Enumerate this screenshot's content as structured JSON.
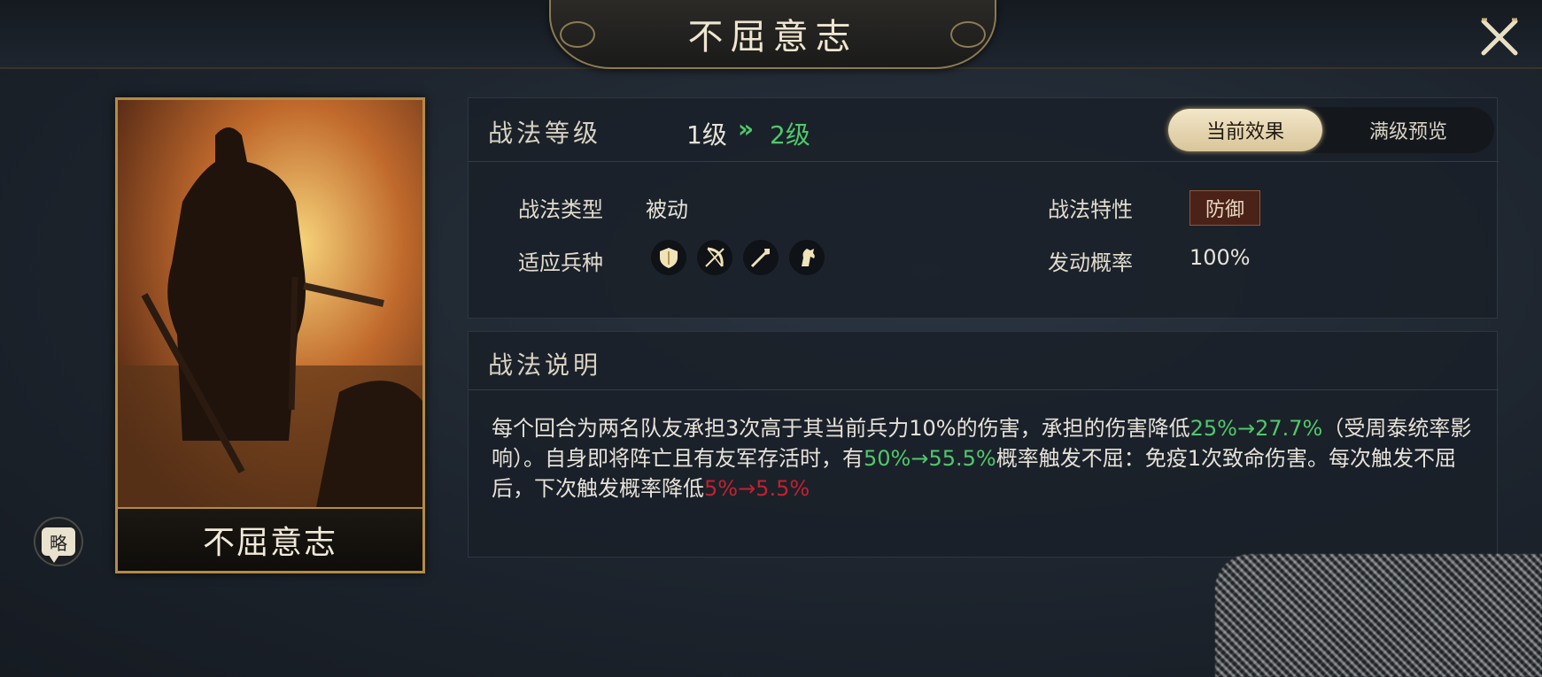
{
  "header": {
    "title": "不屈意志"
  },
  "card": {
    "name": "不屈意志"
  },
  "strategy_button": {
    "label": "略"
  },
  "level": {
    "label": "战法等级",
    "current": "1级",
    "arrow": "»",
    "next": "2级"
  },
  "tabs": [
    {
      "label": "当前效果",
      "active": true
    },
    {
      "label": "满级预览",
      "active": false
    }
  ],
  "attributes": {
    "type_label": "战法类型",
    "type_value": "被动",
    "troops_label": "适应兵种",
    "troop_icons": [
      "shield-icon",
      "bow-icon",
      "spear-icon",
      "horse-icon"
    ],
    "trait_label": "战法特性",
    "trait_value": "防御",
    "rate_label": "发动概率",
    "rate_value": "100%"
  },
  "description": {
    "title": "战法说明",
    "segments": [
      {
        "text": "每个回合为两名队友承担3次高于其当前兵力10%的伤害，承担的伤害降低",
        "style": "normal"
      },
      {
        "text": "25%→27.7%",
        "style": "green"
      },
      {
        "text": "（受周泰统率影响）。自身即将阵亡且有友军存活时，有",
        "style": "normal"
      },
      {
        "text": "50%→55.5%",
        "style": "green"
      },
      {
        "text": "概率触发不屈：免疫1次致命伤害。每次触发不屈后，下次触发概率降低",
        "style": "normal"
      },
      {
        "text": "5%→5.5%",
        "style": "red"
      }
    ]
  },
  "colors": {
    "accent_gold": "#b38b45",
    "highlight_green": "#4fc96a",
    "highlight_red": "#c4202f"
  }
}
